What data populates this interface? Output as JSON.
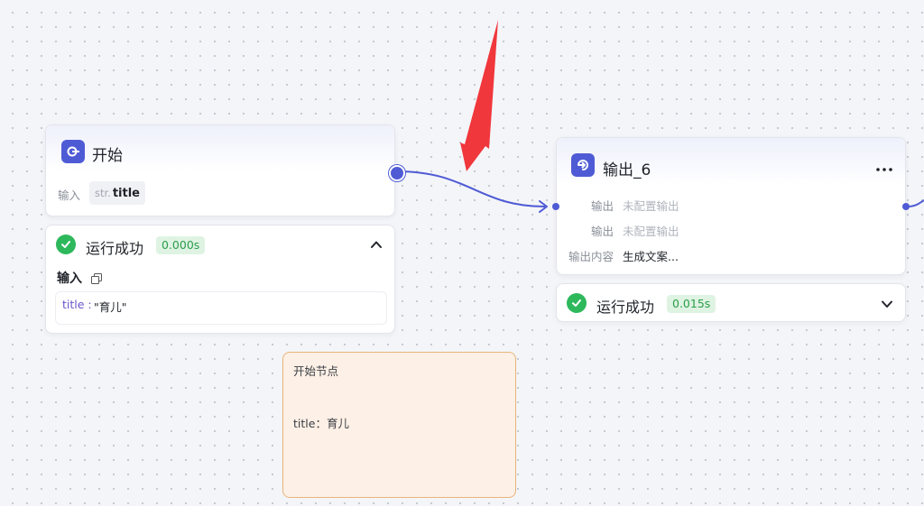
{
  "start_node": {
    "title": "开始",
    "icon": "start-node-icon",
    "input_label": "输入",
    "param_type": "str.",
    "param_name": "title",
    "status": {
      "text": "运行成功",
      "time": "0.000s",
      "expanded": true,
      "toggle_icon": "chevron-up-icon",
      "section_label": "输入",
      "copy_icon": "copy-icon",
      "result_key": "title :",
      "result_value": "\"育儿\""
    }
  },
  "output_node": {
    "title": "输出_6",
    "icon": "output-node-icon",
    "more_icon": "more-icon",
    "rows": [
      {
        "label": "输出",
        "value": "未配置输出"
      },
      {
        "label": "输出",
        "value": "未配置输出"
      },
      {
        "label": "输出内容",
        "value": "生成文案..."
      }
    ],
    "status": {
      "text": "运行成功",
      "time": "0.015s",
      "expanded": false,
      "toggle_icon": "chevron-down-icon"
    }
  },
  "note": {
    "line1": "开始节点",
    "line2": "title：育儿"
  },
  "colors": {
    "accent": "#4f5bd5",
    "success": "#2eb85c",
    "annotation_arrow": "#f0373c",
    "note_border": "#e8b57a",
    "note_bg": "#fdf0e6"
  }
}
